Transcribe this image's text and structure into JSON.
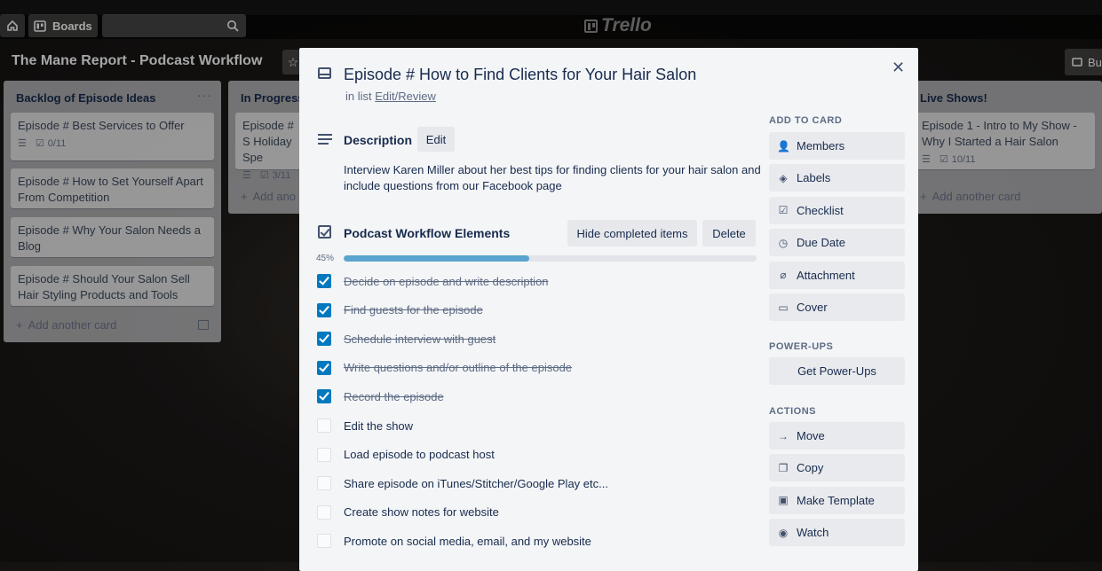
{
  "topbar": {
    "boards_label": "Boards",
    "logo_text": "Trello"
  },
  "board": {
    "title": "The Mane Report - Podcast Workflow",
    "butler_label": "Bu"
  },
  "lists": [
    {
      "title": "Backlog of Episode Ideas",
      "cards": [
        {
          "title": "Episode # Best Services to Offer",
          "checklist": "0/11"
        },
        {
          "title": "Episode # How to Set Yourself Apart From Competition"
        },
        {
          "title": "Episode # Why Your Salon Needs a Blog"
        },
        {
          "title": "Episode # Should Your Salon Sell Hair Styling Products and Tools"
        }
      ],
      "add_label": "Add another card"
    },
    {
      "title": "In Progress",
      "cards": [
        {
          "title": "Episode # S Holiday Spe",
          "checklist": "3/11"
        }
      ],
      "add_label": "Add ano"
    },
    {
      "title": "Live Shows!",
      "cards": [
        {
          "title": "Episode 1 - Intro to My Show - Why I Started a Hair Salon",
          "checklist": "10/11"
        }
      ],
      "add_label": "Add another card"
    }
  ],
  "modal": {
    "title": "Episode # How to Find Clients for Your Hair Salon",
    "in_list_prefix": "in list",
    "list_name": "Edit/Review",
    "description_title": "Description",
    "edit_label": "Edit",
    "description": "Interview Karen Miller about her best tips for finding clients for your hair salon and include questions from our Facebook page",
    "checklist": {
      "title": "Podcast Workflow Elements",
      "hide_label": "Hide completed items",
      "delete_label": "Delete",
      "percent_label": "45%",
      "progress": 0.45,
      "items": [
        {
          "text": "Decide on episode and write description",
          "done": true
        },
        {
          "text": "Find guests for the episode",
          "done": true
        },
        {
          "text": "Schedule interview with guest",
          "done": true
        },
        {
          "text": "Write questions and/or outline of the episode",
          "done": true
        },
        {
          "text": "Record the episode",
          "done": true
        },
        {
          "text": "Edit the show",
          "done": false
        },
        {
          "text": "Load episode to podcast host",
          "done": false
        },
        {
          "text": "Share episode on iTunes/Stitcher/Google Play etc...",
          "done": false
        },
        {
          "text": "Create show notes for website",
          "done": false
        },
        {
          "text": "Promote on social media, email, and my website",
          "done": false
        }
      ]
    },
    "sidebar": {
      "add_to_card": "ADD TO CARD",
      "add_items": [
        {
          "label": "Members",
          "icon": "person-icon"
        },
        {
          "label": "Labels",
          "icon": "tag-icon"
        },
        {
          "label": "Checklist",
          "icon": "checkbox-icon"
        },
        {
          "label": "Due Date",
          "icon": "clock-icon"
        },
        {
          "label": "Attachment",
          "icon": "paperclip-icon"
        },
        {
          "label": "Cover",
          "icon": "card-icon"
        }
      ],
      "power_ups": "POWER-UPS",
      "get_power_ups": "Get Power-Ups",
      "actions": "ACTIONS",
      "action_items": [
        {
          "label": "Move",
          "icon": "arrow-right-icon"
        },
        {
          "label": "Copy",
          "icon": "copy-icon"
        },
        {
          "label": "Make Template",
          "icon": "template-icon"
        },
        {
          "label": "Watch",
          "icon": "eye-icon"
        }
      ]
    }
  }
}
